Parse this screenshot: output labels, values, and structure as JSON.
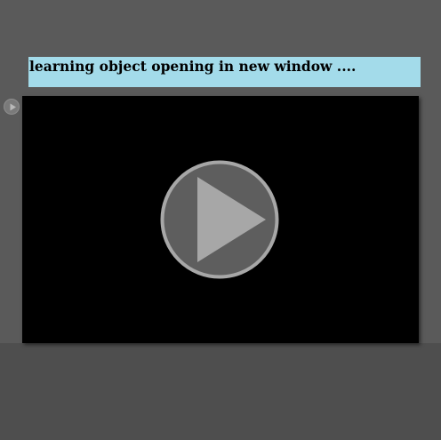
{
  "banner": {
    "text": "learning object opening in new window ...."
  },
  "icons": {
    "small_play": "play-icon",
    "big_play": "play-icon"
  },
  "colors": {
    "background": "#4d4d4d",
    "upper_background": "#5a5a5a",
    "banner_background": "#a3dbea",
    "video_background": "#000000",
    "play_button_fill": "#5e5e5e",
    "play_button_ring": "#a7a7a7",
    "play_triangle": "#a7a7a7"
  }
}
